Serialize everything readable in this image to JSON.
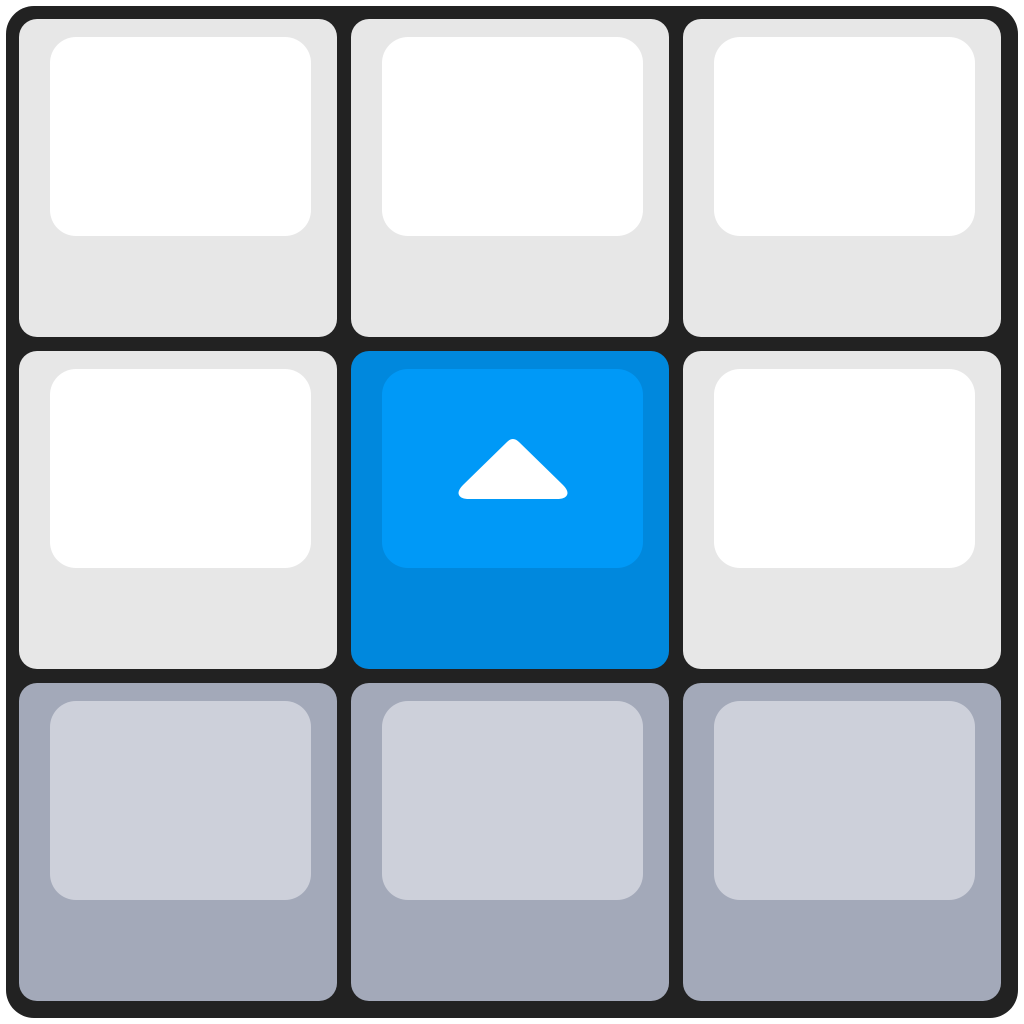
{
  "board": {
    "keys": [
      {
        "id": "top-left",
        "state": "idle",
        "icon": ""
      },
      {
        "id": "top-center",
        "state": "idle",
        "icon": ""
      },
      {
        "id": "top-right",
        "state": "idle",
        "icon": ""
      },
      {
        "id": "middle-left",
        "state": "idle",
        "icon": ""
      },
      {
        "id": "middle-center",
        "state": "pressed",
        "icon": "arrow-up-icon"
      },
      {
        "id": "middle-right",
        "state": "idle",
        "icon": ""
      },
      {
        "id": "bottom-left",
        "state": "disabled",
        "icon": ""
      },
      {
        "id": "bottom-center",
        "state": "disabled",
        "icon": ""
      },
      {
        "id": "bottom-right",
        "state": "disabled",
        "icon": ""
      }
    ]
  },
  "colors": {
    "board_border": "#222222",
    "key_light": "#e7e7e7",
    "key_light_face": "#ffffff",
    "key_dim": "#a3a9b9",
    "key_dim_face": "#cdd0da",
    "key_active": "#0088dd",
    "key_active_face": "#0099f7",
    "icon": "#ffffff"
  }
}
